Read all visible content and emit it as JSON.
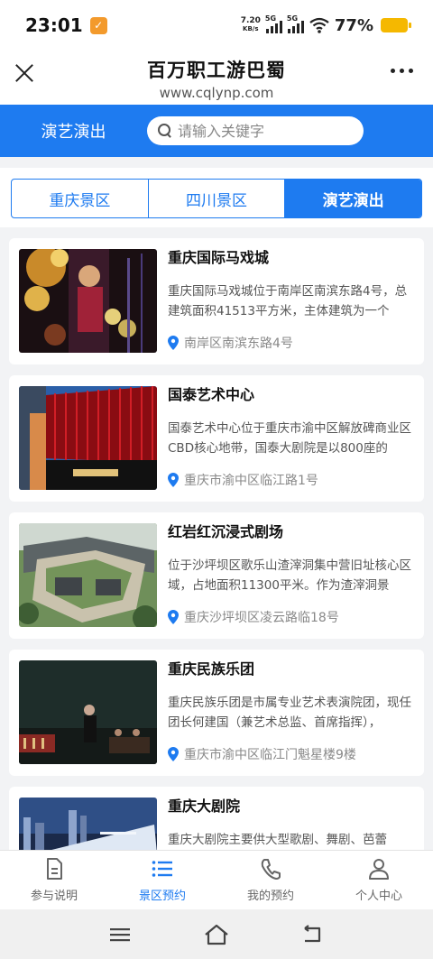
{
  "status_bar": {
    "time": "23:01",
    "net_speed_value": "7.20",
    "net_speed_unit": "KB/s",
    "signal_1": "5G",
    "signal_2": "5G",
    "battery": "77%"
  },
  "title_bar": {
    "title": "百万职工游巴蜀",
    "subtitle": "www.cqlynp.com"
  },
  "header": {
    "section_title": "演艺演出",
    "search_placeholder": "请输入关键字"
  },
  "tabs": [
    {
      "label": "重庆景区",
      "active": false
    },
    {
      "label": "四川景区",
      "active": false
    },
    {
      "label": "演艺演出",
      "active": true
    }
  ],
  "items": [
    {
      "title": "重庆国际马戏城",
      "desc": "重庆国际马戏城位于南岸区南滨东路4号，总建筑面积41513平方米，主体建筑为一个",
      "location": "南岸区南滨东路4号"
    },
    {
      "title": "国泰艺术中心",
      "desc": "国泰艺术中心位于重庆市渝中区解放碑商业区CBD核心地带，国泰大剧院是以800座的",
      "location": "重庆市渝中区临江路1号"
    },
    {
      "title": "红岩红沉浸式剧场",
      "desc": "位于沙坪坝区歌乐山渣滓洞集中营旧址核心区域，占地面积11300平米。作为渣滓洞景",
      "location": "重庆沙坪坝区凌云路临18号"
    },
    {
      "title": "重庆民族乐团",
      "desc": "重庆民族乐团是市属专业艺术表演院团，现任团长何建国（兼艺术总监、首席指挥），",
      "location": "重庆市渝中区临江门魁星楼9楼"
    },
    {
      "title": "重庆大剧院",
      "desc": "重庆大剧院主要供大型歌剧、舞剧、芭蕾",
      "location": ""
    }
  ],
  "bottom_nav": [
    {
      "label": "参与说明",
      "icon": "document-icon",
      "active": false
    },
    {
      "label": "景区预约",
      "icon": "list-icon",
      "active": true
    },
    {
      "label": "我的预约",
      "icon": "phone-icon",
      "active": false
    },
    {
      "label": "个人中心",
      "icon": "user-icon",
      "active": false
    }
  ],
  "colors": {
    "accent": "#1e7bf0",
    "background": "#f2f3f5"
  }
}
